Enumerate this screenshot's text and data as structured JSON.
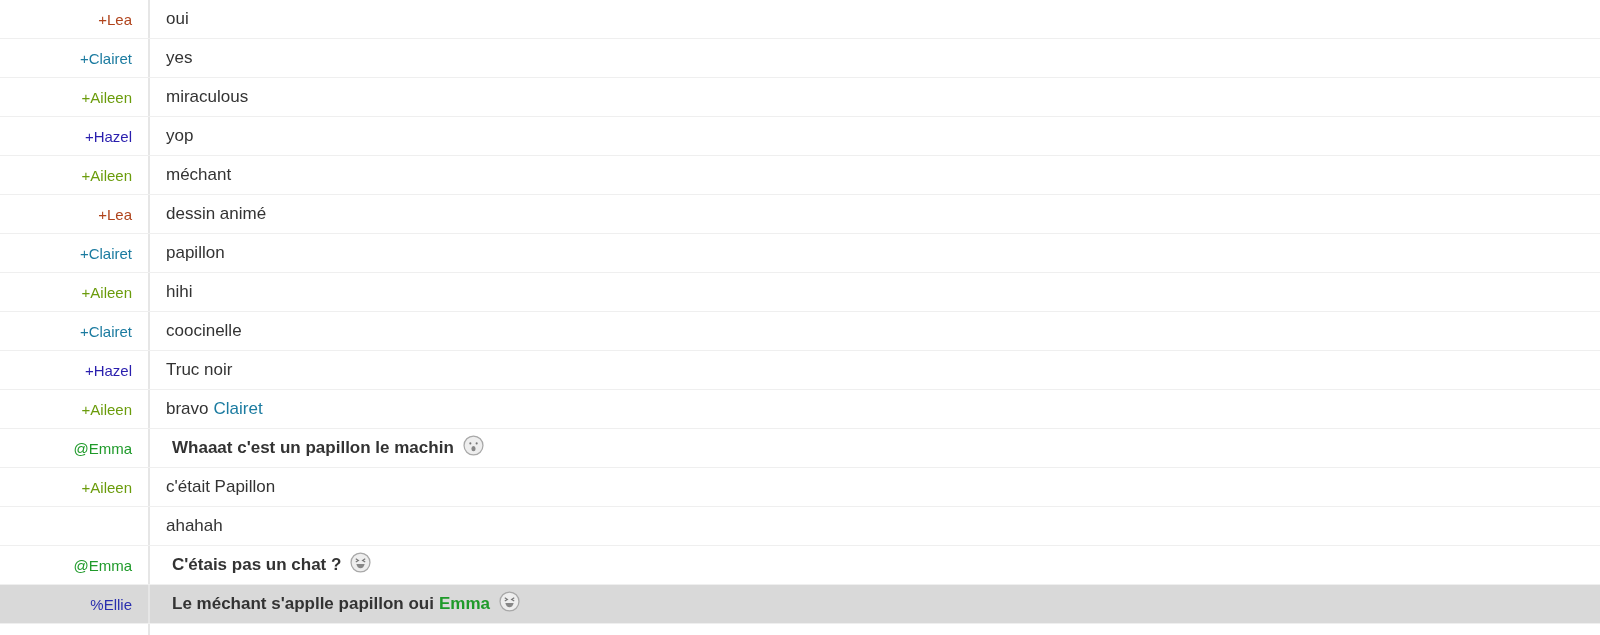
{
  "messages": [
    {
      "nick": "+Lea",
      "color": "#b0441c",
      "text": "oui",
      "bold": false,
      "selected": false
    },
    {
      "nick": "+Clairet",
      "color": "#1b7ba0",
      "text": "yes",
      "bold": false,
      "selected": false
    },
    {
      "nick": "+Aileen",
      "color": "#6b9c0c",
      "text": "miraculous",
      "bold": false,
      "selected": false
    },
    {
      "nick": "+Hazel",
      "color": "#2a1fae",
      "text": "yop",
      "bold": false,
      "selected": false
    },
    {
      "nick": "+Aileen",
      "color": "#6b9c0c",
      "text": "méchant",
      "bold": false,
      "selected": false
    },
    {
      "nick": "+Lea",
      "color": "#b0441c",
      "text": "dessin animé",
      "bold": false,
      "selected": false
    },
    {
      "nick": "+Clairet",
      "color": "#1b7ba0",
      "text": "papillon",
      "bold": false,
      "selected": false
    },
    {
      "nick": "+Aileen",
      "color": "#6b9c0c",
      "text": "hihi",
      "bold": false,
      "selected": false
    },
    {
      "nick": "+Clairet",
      "color": "#1b7ba0",
      "text": "coocinelle",
      "bold": false,
      "selected": false
    },
    {
      "nick": "+Hazel",
      "color": "#2a1fae",
      "text": "Truc noir",
      "bold": false,
      "selected": false
    },
    {
      "nick": "+Aileen",
      "color": "#6b9c0c",
      "text": "bravo",
      "mention": {
        "text": "Clairet",
        "color": "#1b7ba0"
      },
      "bold": false,
      "selected": false
    },
    {
      "nick": "@Emma",
      "color": "#1f9a2a",
      "text": "Whaaat c'est un papillon le machin",
      "emoji": {
        "kind": "surprised"
      },
      "bold": true,
      "selected": false
    },
    {
      "nick": "+Aileen",
      "color": "#6b9c0c",
      "text": "c'était Papillon",
      "bold": false,
      "selected": false
    },
    {
      "text": "ahahah",
      "bold": false,
      "selected": false
    },
    {
      "nick": "@Emma",
      "color": "#1f9a2a",
      "text": "C'étais pas un chat ?",
      "emoji": {
        "kind": "laughing"
      },
      "bold": true,
      "selected": false
    },
    {
      "nick": "%Ellie",
      "color": "#2a2fae",
      "text": "Le méchant s'applle papillon oui",
      "mention": {
        "text": "Emma",
        "color": "#1f9a2a"
      },
      "emoji": {
        "kind": "laughing"
      },
      "bold": true,
      "selected": true
    }
  ]
}
